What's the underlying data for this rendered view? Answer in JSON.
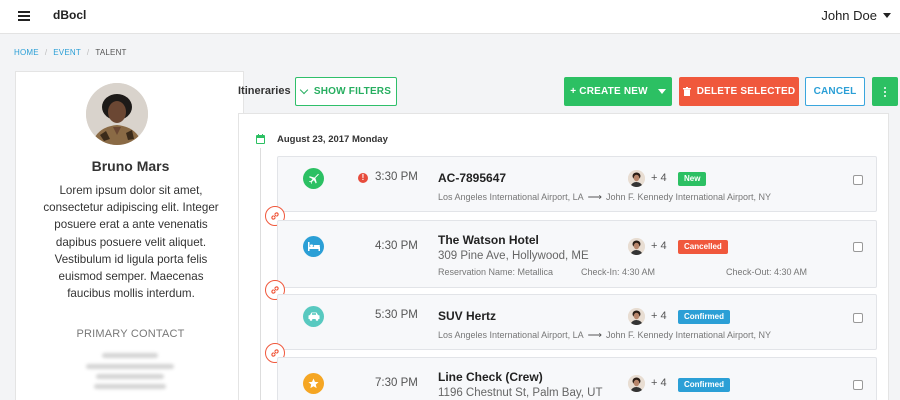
{
  "app": {
    "brand": "dBocl",
    "user": "John Doe"
  },
  "breadcrumb": [
    "HOME",
    "EVENT",
    "TALENT"
  ],
  "profile": {
    "name": "Bruno Mars",
    "bio": "Lorem ipsum dolor sit amet, consectetur adipiscing elit. Integer posuere erat a ante venenatis dapibus posuere velit aliquet. Vestibulum id ligula porta felis euismod semper. Maecenas faucibus mollis interdum.",
    "primary_contact_label": "PRIMARY CONTACT"
  },
  "toolbar": {
    "itineraries_label": "Itineraries",
    "show_filters": "SHOW FILTERS",
    "create_new": "+ CREATE NEW",
    "delete_selected": "DELETE SELECTED",
    "cancel": "CANCEL"
  },
  "date_heading": "August 23, 2017 Monday",
  "colors": {
    "green": "#2cc063",
    "red": "#f0583c",
    "blue": "#2b9fd6",
    "teal": "#58c9c0",
    "orange": "#f5a623"
  },
  "items": [
    {
      "icon": "plane-icon",
      "time": "3:30 PM",
      "alert": "!",
      "title": "AC-7895647",
      "from": "Los Angeles International Airport, LA",
      "to": "John F. Kennedy International Airport, NY",
      "attendees_extra": "+ 4",
      "status": "New"
    },
    {
      "icon": "bed-icon",
      "time": "4:30 PM",
      "title": "The Watson Hotel",
      "address": "309 Pine Ave, Hollywood, ME",
      "reservation": "Reservation Name: Metallica",
      "check_in": "Check-In: 4:30 AM",
      "check_out": "Check-Out: 4:30 AM",
      "attendees_extra": "+ 4",
      "status": "Cancelled"
    },
    {
      "icon": "car-icon",
      "time": "5:30 PM",
      "title": "SUV Hertz",
      "from": "Los Angeles International Airport, LA",
      "to": "John F. Kennedy International Airport, NY",
      "attendees_extra": "+ 4",
      "status": "Confirmed"
    },
    {
      "icon": "star-icon",
      "time": "7:30 PM",
      "title": "Line Check (Crew)",
      "address": "1196 Chestnut St, Palm Bay, UT",
      "attendees_extra": "+ 4",
      "status": "Confirmed"
    }
  ]
}
